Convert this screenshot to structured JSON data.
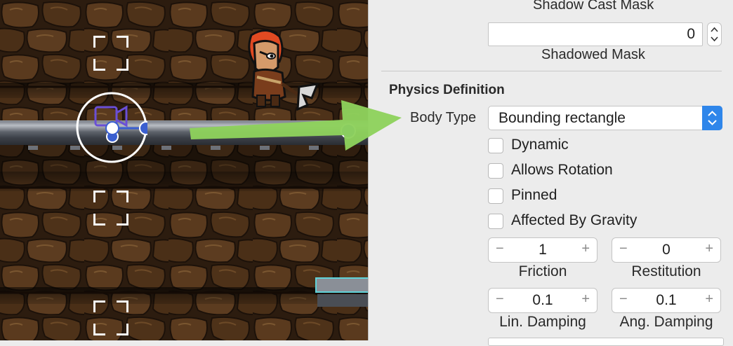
{
  "colors": {
    "accent": "#2f86ea",
    "annotation_arrow": "#8ed15c",
    "selection_handle": "#3a5fd0",
    "camera_icon": "#6a4fd6"
  },
  "scene": {
    "icons": [
      "bracket-icon",
      "camera-icon",
      "warrior-sprite",
      "axe-icon"
    ]
  },
  "inspector": {
    "shadow_cast_mask_label": "Shadow Cast Mask",
    "shadowed_mask": {
      "value": "0",
      "label": "Shadowed Mask"
    },
    "physics": {
      "title": "Physics Definition",
      "body_type_label": "Body Type",
      "body_type_value": "Bounding rectangle",
      "checks": [
        {
          "label": "Dynamic",
          "checked": false
        },
        {
          "label": "Allows Rotation",
          "checked": false
        },
        {
          "label": "Pinned",
          "checked": false
        },
        {
          "label": "Affected By Gravity",
          "checked": false
        }
      ],
      "steppers": [
        {
          "value": "1",
          "label": "Friction",
          "minus": "−",
          "plus": "+"
        },
        {
          "value": "0",
          "label": "Restitution",
          "minus": "−",
          "plus": "+"
        },
        {
          "value": "0.1",
          "label": "Lin. Damping",
          "minus": "−",
          "plus": "+"
        },
        {
          "value": "0.1",
          "label": "Ang. Damping",
          "minus": "−",
          "plus": "+"
        }
      ]
    }
  }
}
